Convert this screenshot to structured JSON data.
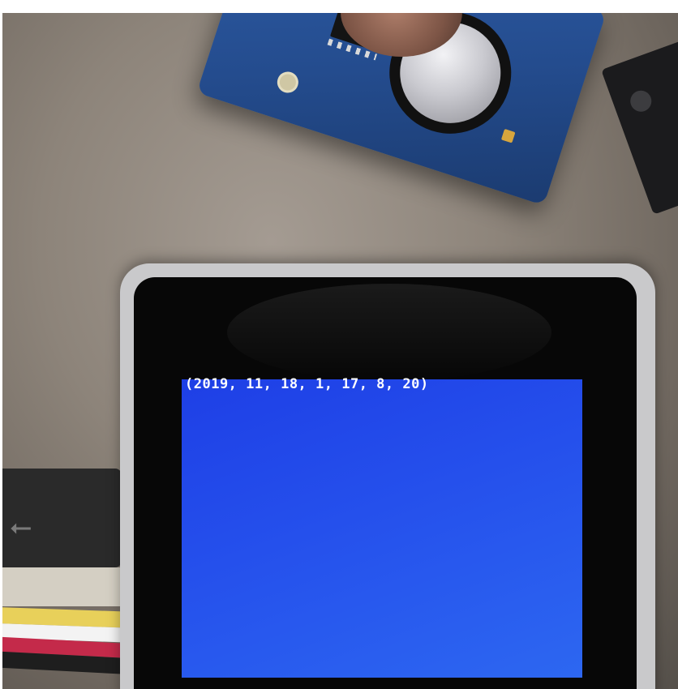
{
  "screen": {
    "readout": "(2019, 11, 18, 1, 17, 8, 20)",
    "background_color": "#2550ec",
    "text_color": "#ffffff"
  },
  "usb_connector": {
    "icon": "usb-icon"
  },
  "scene_colors": {
    "rtc_board": "#2f5ea8",
    "device_case": "#c9c9cb",
    "table_surface": "#8d847a"
  }
}
